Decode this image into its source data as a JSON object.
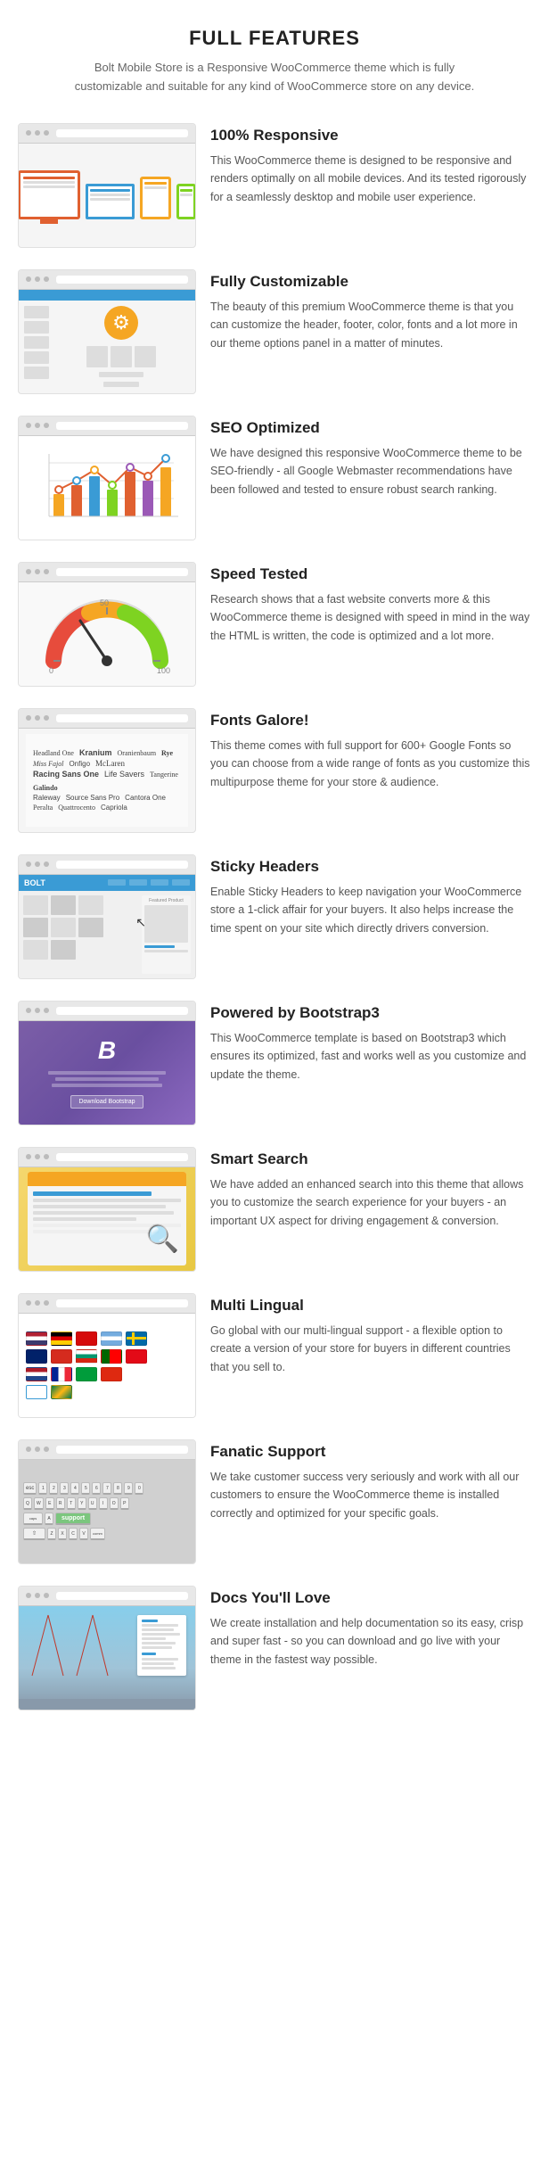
{
  "page": {
    "title": "FULL FEATURES",
    "subtitle": "Bolt Mobile Store is a Responsive WooCommerce theme which is fully customizable and suitable for any kind of WooCommerce store on any device."
  },
  "features": [
    {
      "id": "responsive",
      "title": "100% Responsive",
      "description": "This WooCommerce theme is designed to be responsive and renders optimally on all mobile devices. And its tested rigorously for a seamlessly desktop and mobile user experience."
    },
    {
      "id": "customizable",
      "title": "Fully Customizable",
      "description": "The beauty of this premium WooCommerce theme is that you can customize the header, footer, color, fonts and a lot more in our theme options panel in a matter of minutes."
    },
    {
      "id": "seo",
      "title": "SEO Optimized",
      "description": "We have designed this responsive WooCommerce theme to be SEO-friendly - all Google Webmaster recommendations have been followed and tested to ensure robust search ranking."
    },
    {
      "id": "speed",
      "title": "Speed Tested",
      "description": "Research shows that a fast website converts more & this WooCommerce theme is designed with speed in mind in the way the HTML is written, the code is optimized and a lot more."
    },
    {
      "id": "fonts",
      "title": "Fonts Galore!",
      "description": "This theme comes with full support for 600+ Google Fonts so you can choose from a wide range of fonts as you customize this multipurpose theme for your store & audience.",
      "font_names": [
        "Headland One",
        "Kranium",
        "Oranienbaum",
        "Rye",
        "Miss Fajol",
        "Onfigo",
        "McLaren",
        "Racing Sans One",
        "Life Savers",
        "Tangerine",
        "Galindo",
        "Raleway",
        "Source Sans Pro",
        "Cantora One",
        "Peralta",
        "Quattrocento",
        "Capriola"
      ]
    },
    {
      "id": "sticky",
      "title": "Sticky Headers",
      "description": "Enable Sticky Headers to keep navigation your WooCommerce store a 1-click affair for your buyers. It also helps increase the time spent on your site which directly drivers conversion."
    },
    {
      "id": "bootstrap",
      "title": "Powered by Bootstrap3",
      "description": "This WooCommerce template is based on Bootstrap3 which ensures its optimized, fast and works well as you customize and update the theme.",
      "bs_label": "B",
      "bs_tagline": "Bootstrap is the most popular HTML, CSS, and JS framework for developing responsive, mobile first projects on the web.",
      "bs_button": "Download Bootstrap"
    },
    {
      "id": "search",
      "title": "Smart Search",
      "description": "We have added an enhanced search into this theme that allows you to customize the search experience for your buyers - an important UX aspect for driving engagement & conversion."
    },
    {
      "id": "multilingual",
      "title": "Multi Lingual",
      "description": "Go global with our multi-lingual support - a flexible option to create a version of your store for buyers in different countries that you sell to."
    },
    {
      "id": "support",
      "title": "Fanatic Support",
      "description": "We take customer success very seriously and work with all our customers to ensure the WooCommerce theme is installed correctly and optimized for your specific goals.",
      "support_key": "support"
    },
    {
      "id": "docs",
      "title": "Docs You'll Love",
      "description": "We create installation and help documentation so its easy, crisp and super fast - so you can download and go live with your theme in the fastest way possible."
    }
  ]
}
